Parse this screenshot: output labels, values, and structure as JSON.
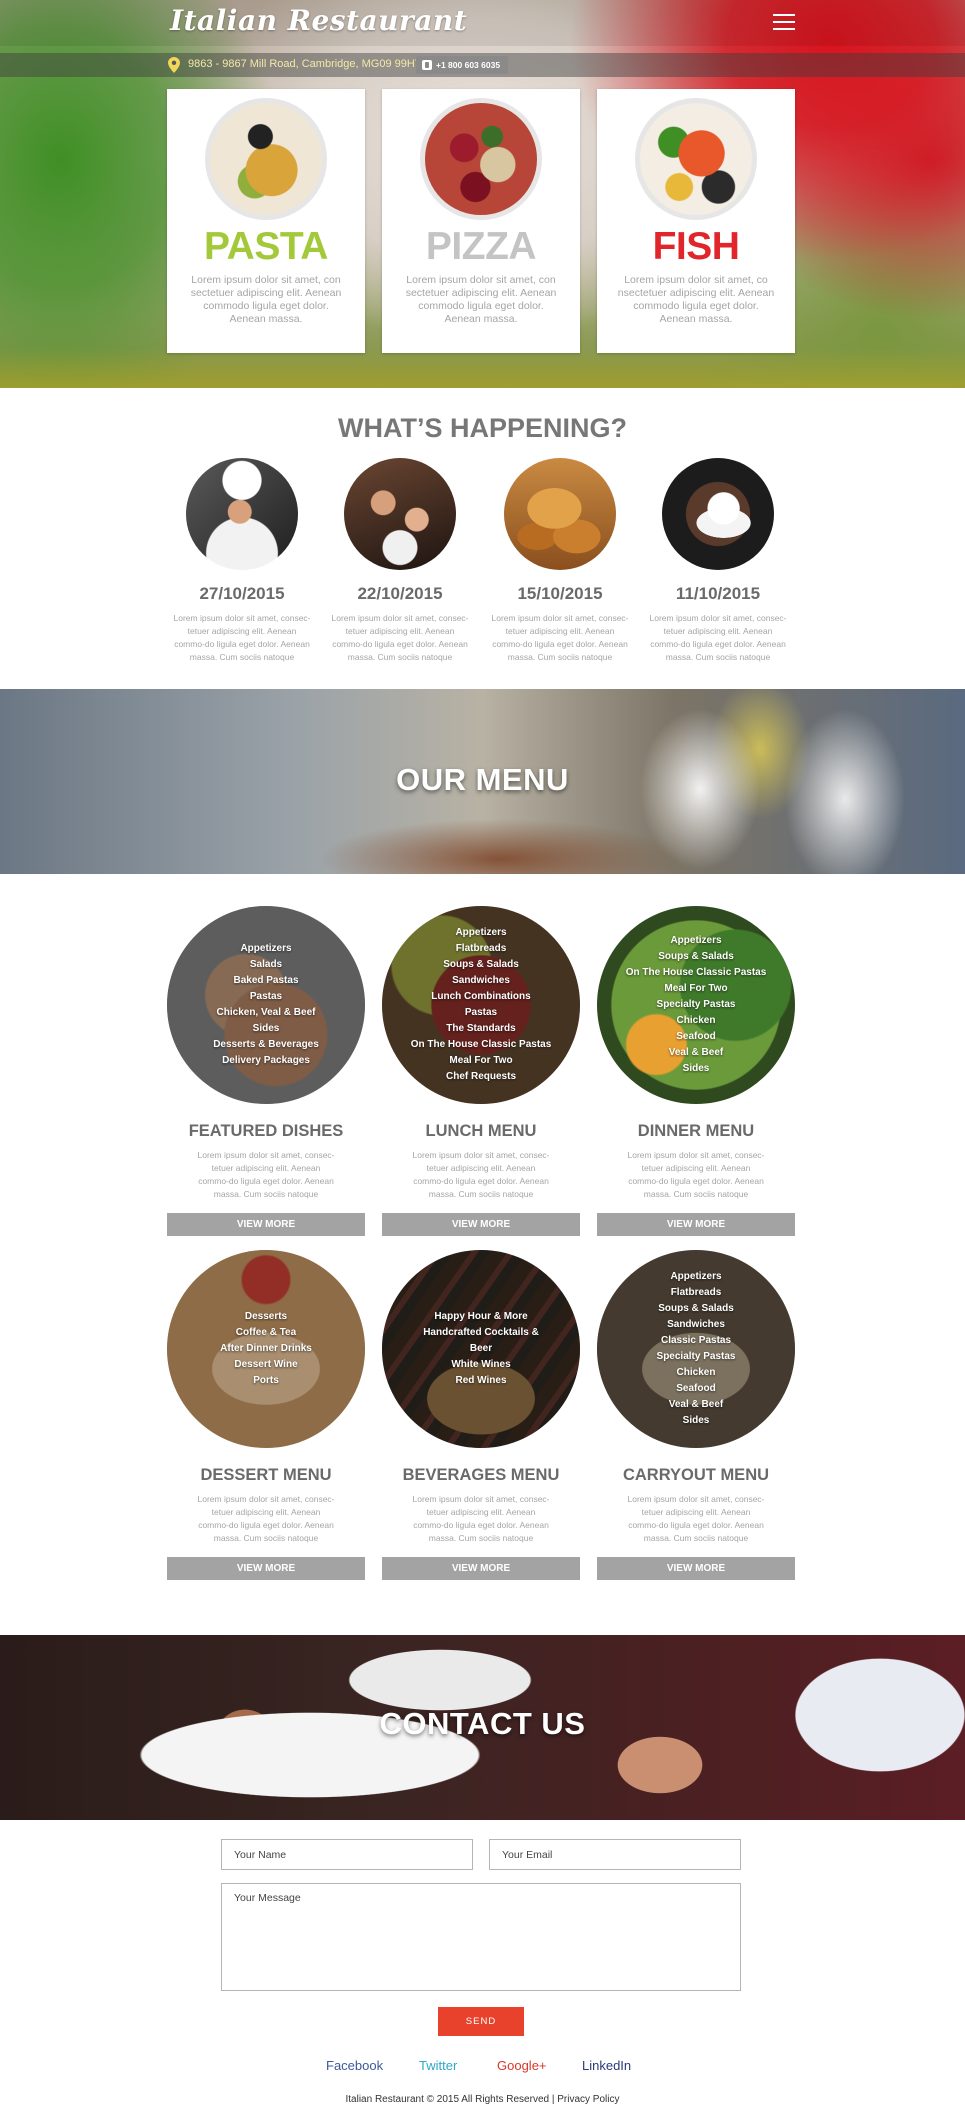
{
  "brand": {
    "logo": "Italian Restaurant"
  },
  "header": {
    "address": "9863 - 9867 Mill Road, Cambridge, MG09 99HT.",
    "phone": "+1 800 603 6035"
  },
  "hero_cards": [
    {
      "title": "PASTA",
      "color": "#a3c93a",
      "desc": "Lorem ipsum dolor sit amet, con sectetuer adipiscing elit. Aenean commodo ligula eget dolor. Aenean massa."
    },
    {
      "title": "PIZZA",
      "color": "#c4c4c4",
      "desc": "Lorem ipsum dolor sit amet, con sectetuer adipiscing elit. Aenean commodo ligula eget dolor. Aenean massa."
    },
    {
      "title": "FISH",
      "color": "#e0262a",
      "desc": "Lorem ipsum dolor sit amet, co nsectetuer adipiscing elit. Aenean commodo ligula eget dolor. Aenean massa."
    }
  ],
  "happening": {
    "title": "WHAT’S HAPPENING?",
    "events": [
      {
        "date": "27/10/2015",
        "desc": "Lorem ipsum dolor sit amet, consec-tetuer adipiscing elit. Aenean commo-do ligula eget dolor. Aenean massa. Cum sociis natoque"
      },
      {
        "date": "22/10/2015",
        "desc": "Lorem ipsum dolor sit amet, consec-tetuer adipiscing elit. Aenean commo-do ligula eget dolor. Aenean massa. Cum sociis natoque"
      },
      {
        "date": "15/10/2015",
        "desc": "Lorem ipsum dolor sit amet, consec-tetuer adipiscing elit. Aenean commo-do ligula eget dolor. Aenean massa. Cum sociis natoque"
      },
      {
        "date": "11/10/2015",
        "desc": "Lorem ipsum dolor sit amet, consec-tetuer adipiscing elit. Aenean commo-do ligula eget dolor. Aenean massa. Cum sociis natoque"
      }
    ]
  },
  "menu": {
    "banner": "OUR MENU",
    "button_label": "VIEW MORE",
    "desc": "Lorem ipsum dolor sit amet, consec-tetuer adipiscing elit. Aenean commo-do ligula eget dolor. Aenean massa. Cum sociis natoque",
    "items": [
      {
        "title": "FEATURED DISHES",
        "list": [
          "Appetizers",
          "Salads",
          "Baked Pastas",
          "Pastas",
          "Chicken, Veal & Beef",
          "Sides",
          "Desserts & Beverages",
          "Delivery Packages"
        ]
      },
      {
        "title": "LUNCH MENU",
        "list": [
          "Appetizers",
          "Flatbreads",
          "Soups & Salads",
          "Sandwiches",
          "Lunch Combinations",
          "Pastas",
          "The Standards",
          "On The House Classic Pastas",
          "Meal For Two",
          "Chef Requests"
        ]
      },
      {
        "title": "DINNER MENU",
        "list": [
          "Appetizers",
          "Soups & Salads",
          "On The House Classic Pastas",
          "Meal For Two",
          "Specialty Pastas",
          "Chicken",
          "Seafood",
          "Veal & Beef",
          "Sides"
        ]
      },
      {
        "title": "DESSERT MENU",
        "list": [
          "Desserts",
          "Coffee & Tea",
          "After Dinner Drinks",
          "Dessert Wine",
          "Ports"
        ]
      },
      {
        "title": "BEVERAGES MENU",
        "list": [
          "Happy Hour & More",
          "Handcrafted Cocktails &",
          "Beer",
          "White Wines",
          "Red Wines"
        ]
      },
      {
        "title": "CARRYOUT MENU",
        "list": [
          "Appetizers",
          "Flatbreads",
          "Soups & Salads",
          "Sandwiches",
          "Classic Pastas",
          "Specialty Pastas",
          "Chicken",
          "Seafood",
          "Veal & Beef",
          "Sides"
        ]
      }
    ]
  },
  "contact": {
    "banner": "CONTACT US",
    "name_placeholder": "Your Name",
    "email_placeholder": "Your Email",
    "message_placeholder": "Your Message",
    "send_label": "SEND"
  },
  "social": [
    {
      "label": "Facebook",
      "color": "#3b5a9a"
    },
    {
      "label": "Twitter",
      "color": "#2aa9c9"
    },
    {
      "label": "Google+",
      "color": "#d8372a"
    },
    {
      "label": "LinkedIn",
      "color": "#2a3a7a"
    }
  ],
  "footer": {
    "copyright": "Italian Restaurant © 2015 All Rights Reserved",
    "separator": "|",
    "privacy": "Privacy Policy"
  }
}
